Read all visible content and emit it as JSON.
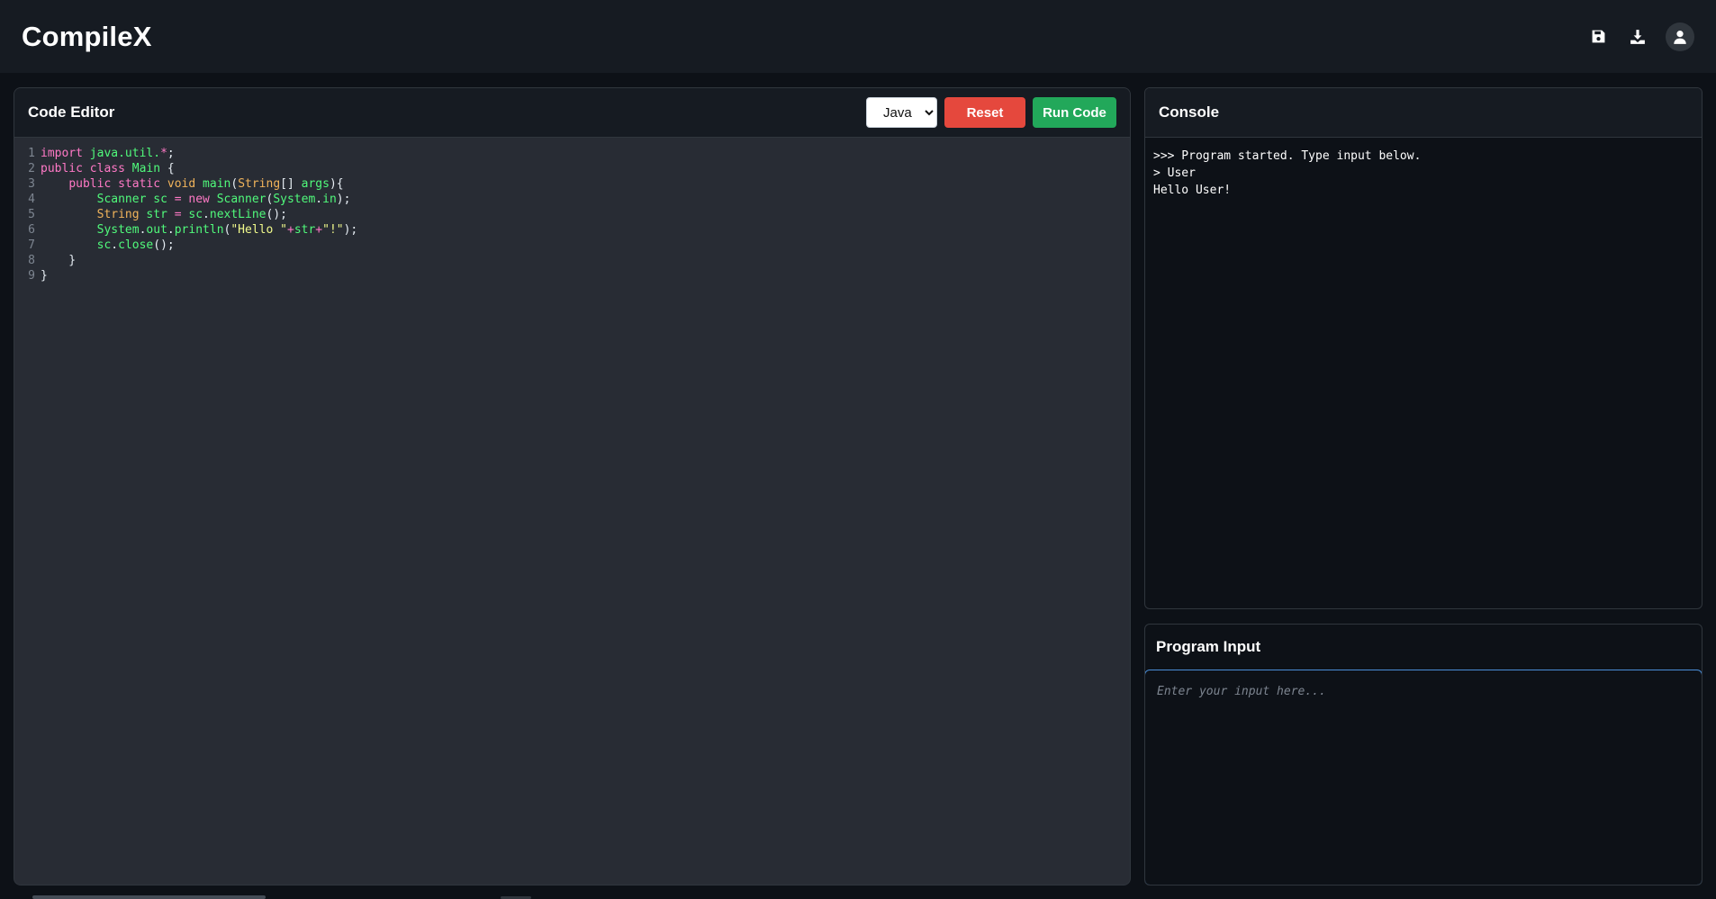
{
  "app": {
    "title": "CompileX"
  },
  "toolbar": {
    "icons": [
      "save-icon",
      "download-icon",
      "user-avatar-icon"
    ]
  },
  "editor": {
    "title": "Code Editor",
    "language_selected": "Java",
    "language_options": [
      "Java"
    ],
    "reset_label": "Reset",
    "run_label": "Run Code",
    "lines": [
      {
        "n": "1",
        "tokens": [
          {
            "t": "import",
            "c": "kw"
          },
          {
            "t": " java.util.",
            "c": "id"
          },
          {
            "t": "*",
            "c": "kw"
          },
          {
            "t": ";",
            "c": "pl"
          }
        ]
      },
      {
        "n": "2",
        "tokens": [
          {
            "t": "public",
            "c": "kw"
          },
          {
            "t": " ",
            "c": "pl"
          },
          {
            "t": "class",
            "c": "kw"
          },
          {
            "t": " ",
            "c": "pl"
          },
          {
            "t": "Main",
            "c": "id"
          },
          {
            "t": " {",
            "c": "pl"
          }
        ]
      },
      {
        "n": "3",
        "tokens": [
          {
            "t": "    ",
            "c": "pl"
          },
          {
            "t": "public",
            "c": "kw"
          },
          {
            "t": " ",
            "c": "pl"
          },
          {
            "t": "static",
            "c": "kw"
          },
          {
            "t": " ",
            "c": "pl"
          },
          {
            "t": "void",
            "c": "ty"
          },
          {
            "t": " ",
            "c": "pl"
          },
          {
            "t": "main",
            "c": "id"
          },
          {
            "t": "(",
            "c": "pl"
          },
          {
            "t": "String",
            "c": "ty"
          },
          {
            "t": "[] ",
            "c": "pl"
          },
          {
            "t": "args",
            "c": "id"
          },
          {
            "t": "){",
            "c": "pl"
          }
        ]
      },
      {
        "n": "4",
        "tokens": [
          {
            "t": "        ",
            "c": "pl"
          },
          {
            "t": "Scanner",
            "c": "id"
          },
          {
            "t": " ",
            "c": "pl"
          },
          {
            "t": "sc",
            "c": "id"
          },
          {
            "t": " ",
            "c": "pl"
          },
          {
            "t": "=",
            "c": "kw"
          },
          {
            "t": " ",
            "c": "pl"
          },
          {
            "t": "new",
            "c": "kw"
          },
          {
            "t": " ",
            "c": "pl"
          },
          {
            "t": "Scanner",
            "c": "id"
          },
          {
            "t": "(",
            "c": "pl"
          },
          {
            "t": "System",
            "c": "id"
          },
          {
            "t": ".",
            "c": "pl"
          },
          {
            "t": "in",
            "c": "id"
          },
          {
            "t": ");",
            "c": "pl"
          }
        ]
      },
      {
        "n": "5",
        "tokens": [
          {
            "t": "        ",
            "c": "pl"
          },
          {
            "t": "String",
            "c": "ty"
          },
          {
            "t": " ",
            "c": "pl"
          },
          {
            "t": "str",
            "c": "id"
          },
          {
            "t": " ",
            "c": "pl"
          },
          {
            "t": "=",
            "c": "kw"
          },
          {
            "t": " ",
            "c": "pl"
          },
          {
            "t": "sc",
            "c": "id"
          },
          {
            "t": ".",
            "c": "pl"
          },
          {
            "t": "nextLine",
            "c": "id"
          },
          {
            "t": "();",
            "c": "pl"
          }
        ]
      },
      {
        "n": "6",
        "tokens": [
          {
            "t": "        ",
            "c": "pl"
          },
          {
            "t": "System",
            "c": "id"
          },
          {
            "t": ".",
            "c": "pl"
          },
          {
            "t": "out",
            "c": "id"
          },
          {
            "t": ".",
            "c": "pl"
          },
          {
            "t": "println",
            "c": "id"
          },
          {
            "t": "(",
            "c": "pl"
          },
          {
            "t": "\"Hello \"",
            "c": "str"
          },
          {
            "t": "+",
            "c": "kw"
          },
          {
            "t": "str",
            "c": "id"
          },
          {
            "t": "+",
            "c": "kw"
          },
          {
            "t": "\"!\"",
            "c": "str"
          },
          {
            "t": ");",
            "c": "pl"
          }
        ]
      },
      {
        "n": "7",
        "tokens": [
          {
            "t": "        ",
            "c": "pl"
          },
          {
            "t": "sc",
            "c": "id"
          },
          {
            "t": ".",
            "c": "pl"
          },
          {
            "t": "close",
            "c": "id"
          },
          {
            "t": "();",
            "c": "pl"
          }
        ]
      },
      {
        "n": "8",
        "tokens": [
          {
            "t": "    }",
            "c": "pl"
          }
        ]
      },
      {
        "n": "9",
        "tokens": [
          {
            "t": "}",
            "c": "pl"
          }
        ]
      }
    ]
  },
  "console": {
    "title": "Console",
    "lines": [
      ">>> Program started. Type input below.",
      "> User",
      "Hello User!"
    ]
  },
  "program_input": {
    "title": "Program Input",
    "placeholder": "Enter your input here...",
    "value": ""
  },
  "colors": {
    "keyword": "#ff79c6",
    "type": "#f0b35b",
    "identifier": "#50fa7b",
    "string": "#f1fa8c",
    "reset_button": "#e5483d",
    "run_button": "#22a85a",
    "input_focus_border": "#4a8ed8"
  }
}
